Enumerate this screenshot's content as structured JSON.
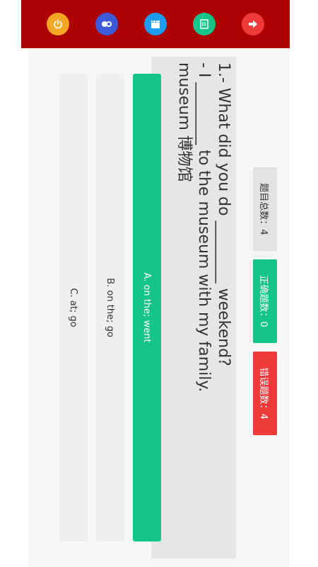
{
  "toolbar": {
    "buttons": [
      {
        "icon": "power-icon",
        "color": "#f5a623"
      },
      {
        "icon": "users-icon",
        "color": "#3b5bdb"
      },
      {
        "icon": "clapperboard-icon",
        "color": "#1c9bf0"
      },
      {
        "icon": "notebook-icon",
        "color": "#15c48a"
      },
      {
        "icon": "arrow-right-icon",
        "color": "#f03a3a"
      }
    ]
  },
  "counters": {
    "total_label": "题目总数：4",
    "correct_label": "正确题数：0",
    "wrong_label": "错误题数：4"
  },
  "question": {
    "line1": "1.- What did you do ________ weekend?",
    "line2": "- I ________ to the museum with my family.",
    "line3": "museum 博物馆"
  },
  "options": [
    {
      "label": "A. on the; went",
      "selected": true
    },
    {
      "label": "B. on the; go",
      "selected": false
    },
    {
      "label": "C. at; go",
      "selected": false
    }
  ],
  "colors": {
    "toolbar_bg": "#ad0000",
    "correct": "#15c48a",
    "wrong": "#f03a3a",
    "neutral": "#e2e2e2"
  }
}
